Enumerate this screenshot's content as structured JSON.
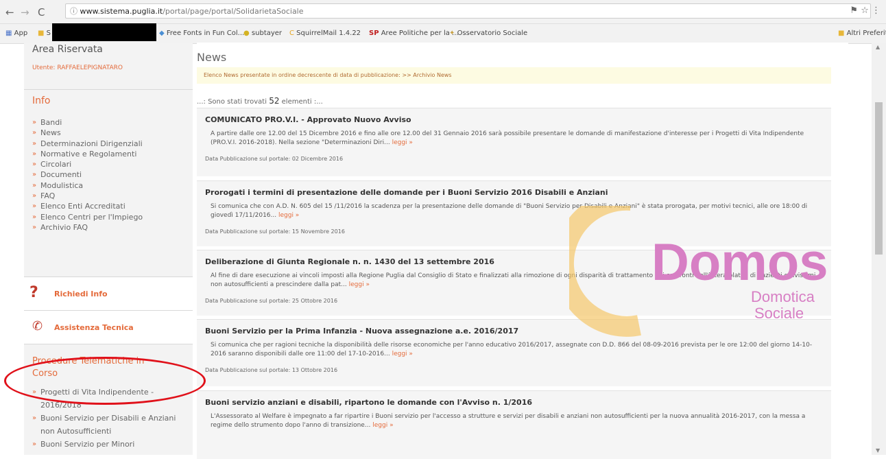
{
  "browser": {
    "url_host": "www.sistema.puglia.it",
    "url_path": "/portal/page/portal/SolidarietaSociale",
    "bookmarks": [
      "App",
      "Free Fonts in Fun Col...",
      "subtayer",
      "SquirrelMail 1.4.22",
      "Aree Politiche per la ...",
      "Osservatorio Sociale",
      "Altri Preferiti"
    ]
  },
  "sidebar": {
    "area_title": "Area Riservata",
    "utente": "Utente: RAFFAELEPIGNATARO",
    "info_title": "Info",
    "info_items": [
      "Bandi",
      "News",
      "Determinazioni Dirigenziali",
      "Normative e Regolamenti",
      "Circolari",
      "Documenti",
      "Modulistica",
      "FAQ",
      "Elenco Enti Accreditati",
      "Elenco Centri per l'Impiego",
      "Archivio FAQ"
    ],
    "richiedi_info": "Richiedi Info",
    "assistenza": "Assistenza Tecnica",
    "procedure_title": "Procedure Telematiche in Corso",
    "procedure_items": [
      "Progetti di Vita Indipendente - 2016/2018",
      "Buoni Servizio per Disabili e Anziani non Autosufficienti",
      "Buoni Servizio per Minori"
    ]
  },
  "main": {
    "title": "News",
    "notice": "Elenco News presentate in ordine decrescente di data di pubblicazione: >> Archivio News",
    "found_prefix": "...: Sono stati trovati",
    "found_count": "52",
    "found_suffix": "elementi :...",
    "items": [
      {
        "title": "COMUNICATO PRO.V.I. - Approvato Nuovo Avviso",
        "body": "A partire dalle ore 12.00 del 15 Dicembre 2016 e fino alle ore 12.00 del 31 Gennaio 2016 sarà possibile presentare le domande di manifestazione d'interesse per i Progetti di Vita Indipendente (PRO.V.I. 2016-2018). Nella sezione \"Determinazioni Diri...",
        "read": "leggi »",
        "date": "Data Pubblicazione sul portale: 02 Dicembre 2016"
      },
      {
        "title": "Prorogati i termini di presentazione delle domande per i Buoni Servizio 2016 Disabili e Anziani",
        "body": "Si comunica che con A.D. N. 605 del 15 /11/2016 la scadenza per la presentazione delle domande di \"Buoni Servizio per Disabili e Anziani\" è stata prorogata, per motivi tecnici, alle ore 18:00 di giovedì 17/11/2016...",
        "read": "leggi »",
        "date": "Data Pubblicazione sul portale: 15 Novembre 2016"
      },
      {
        "title": "Deliberazione di Giunta Regionale n. n. 1430 del 13 settembre 2016",
        "body": "Al fine di dare esecuzione ai vincoli imposti alla Regione Puglia dal Consiglio di Stato e finalizzati alla rimozione di ogni disparità di trattamento nei confronti dell'intera platea di pazienti gravissimi non autosufficienti a prescindere dalla pat...",
        "read": "leggi »",
        "date": "Data Pubblicazione sul portale: 25 Ottobre 2016"
      },
      {
        "title": "Buoni Servizio per la Prima Infanzia - Nuova assegnazione a.e. 2016/2017",
        "body": "Si comunica che per ragioni tecniche la disponibilità delle risorse economiche per l'anno educativo 2016/2017, assegnate con D.D. 866 del 08-09-2016 prevista per le ore 12:00 del giorno 14-10-2016 saranno disponibili dalle ore 11:00 del 17-10-2016...",
        "read": "leggi »",
        "date": "Data Pubblicazione sul portale: 13 Ottobre 2016"
      },
      {
        "title": "Buoni servizio anziani e disabili, ripartono le domande con l'Avviso n. 1/2016",
        "body": "L'Assessorato al Welfare è impegnato a far ripartire i Buoni servizio per l'accesso a strutture e servizi per disabili e anziani non autosufficienti per la nuova annualità 2016-2017, con la messa a regime dello strumento dopo l'anno di transizione...",
        "read": "leggi »",
        "date": ""
      }
    ]
  },
  "logo": {
    "word": "Domos",
    "line1": "Domotica",
    "line2": "Sociale"
  },
  "colors": {
    "accent": "#e46a3a",
    "logo_pink": "#d77fc4",
    "logo_gold": "#f5c86b",
    "ellipse": "#e0111a"
  }
}
